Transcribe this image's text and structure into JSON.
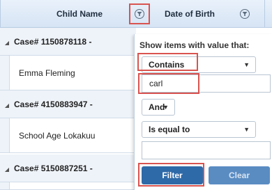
{
  "grid": {
    "columns": [
      {
        "label": "Child Name"
      },
      {
        "label": "Date of Birth"
      }
    ],
    "groups": [
      {
        "label": "Case# 1150878118 -",
        "child_name": "Emma Fleming"
      },
      {
        "label": "Case# 4150883947 -",
        "child_name": "School Age Lokakuu"
      },
      {
        "label": "Case# 5150887251 -",
        "child_name": ""
      }
    ]
  },
  "filter_menu": {
    "title": "Show items with value that:",
    "operator1": "Contains",
    "value1": "carl",
    "logic": "And",
    "operator2": "Is equal to",
    "value2": "",
    "filter_label": "Filter",
    "clear_label": "Clear"
  },
  "colors": {
    "highlight": "#d9534f",
    "primary_button": "#2f6aa8"
  }
}
